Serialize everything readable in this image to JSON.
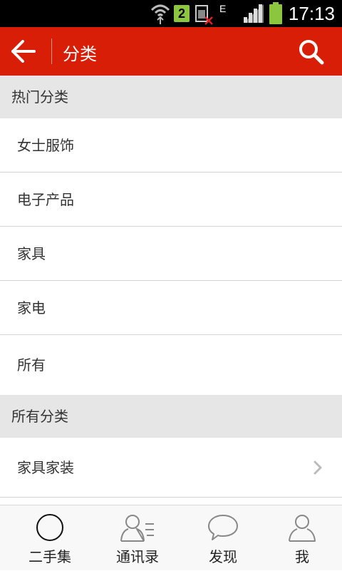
{
  "status_bar": {
    "sim_label": "2",
    "network_label": "E",
    "time": "17:13"
  },
  "app_bar": {
    "title": "分类",
    "background_color": "#d81e06"
  },
  "sections": [
    {
      "title": "热门分类",
      "items": [
        "女士服饰",
        "电子产品",
        "家具",
        "家电",
        "所有"
      ]
    },
    {
      "title": "所有分类",
      "items": [
        "家具家装"
      ]
    }
  ],
  "bottom_nav": {
    "tabs": [
      {
        "label": "二手集",
        "icon": "circle-icon"
      },
      {
        "label": "通讯录",
        "icon": "contacts-icon"
      },
      {
        "label": "发现",
        "icon": "chat-bubble-icon"
      },
      {
        "label": "我",
        "icon": "person-icon"
      }
    ]
  }
}
